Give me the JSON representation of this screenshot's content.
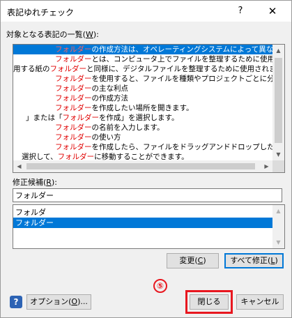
{
  "window": {
    "title": "表記ゆれチェック",
    "help_glyph": "?",
    "close_glyph": "✕"
  },
  "list_section": {
    "label": "対象となる表記の一覧(",
    "accel": "W",
    "label_suffix": "):",
    "rows": [
      {
        "pre": "",
        "kw": "フォルダー",
        "post": "の作成方法は、オペレーティングシステムによって異なります",
        "selected": true
      },
      {
        "pre": "",
        "kw": "フォルダー",
        "post": "とは、コンピュータ上でファイルを整理するために使用する入",
        "selected": false
      },
      {
        "pre": "用する紙の",
        "kw": "フォルダー",
        "post": "と同様に、デジタルファイルを整理するために使用されます。",
        "selected": false
      },
      {
        "pre": "",
        "kw": "フォルダー",
        "post": "を使用すると、ファイルを種類やプロジェクトごとに分類して",
        "selected": false
      },
      {
        "pre": "",
        "kw": "フォルダー",
        "post": "の主な利点",
        "selected": false
      },
      {
        "pre": "",
        "kw": "フォルダー",
        "post": "の作成方法",
        "selected": false
      },
      {
        "pre": "",
        "kw": "フォルダー",
        "post": "を作成したい場所を開きます。",
        "selected": false
      },
      {
        "pre": "」または「",
        "kw": "フォルダー",
        "post": "を作成」を選択します。",
        "selected": false
      },
      {
        "pre": "",
        "kw": "フォルダー",
        "post": "の名前を入力します。",
        "selected": false
      },
      {
        "pre": "",
        "kw": "フォルダー",
        "post": "の使い方",
        "selected": false
      },
      {
        "pre": "",
        "kw": "フォルダー",
        "post": "を作成したら、ファイルをドラッグアンドドロップしたり、右クリ",
        "selected": false
      },
      {
        "pre": "選択して、",
        "kw": "フォルダー",
        "post": "に移動することができます。",
        "selected": false
      }
    ]
  },
  "candidate_section": {
    "label": "修正候補(",
    "accel": "R",
    "label_suffix": "):",
    "input_value": "フォルダー",
    "options": [
      {
        "label": "フォルダ",
        "selected": false
      },
      {
        "label": "フォルダー",
        "selected": true
      }
    ]
  },
  "buttons": {
    "change_label": "変更(",
    "change_accel": "C",
    "change_suffix": ")",
    "fix_all_label": "すべて修正(",
    "fix_all_accel": "L",
    "fix_all_suffix": ")",
    "options_label": "オプション(",
    "options_accel": "O",
    "options_suffix": ")...",
    "close_label": "閉じる",
    "cancel_label": "キャンセル"
  },
  "annotation": {
    "step_number": "⑤",
    "accent_color": "#e8171f"
  },
  "colors": {
    "keyword": "#e00000",
    "selection": "#0078d7"
  },
  "icons": {
    "help_icon": "?"
  }
}
